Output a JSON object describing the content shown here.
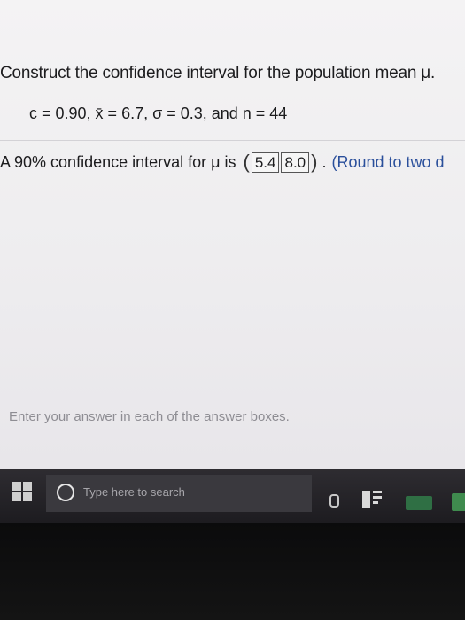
{
  "question": {
    "prompt": "Construct the confidence interval for the population mean μ.",
    "given": "c = 0.90, x̄ = 6.7, σ = 0.3, and n = 44"
  },
  "answer": {
    "prefix": "A 90% confidence interval for μ is",
    "open_paren": "(",
    "lower_value": "5.4",
    "upper_value": "8.0",
    "close_paren": ")",
    "dot": ".",
    "round_note": "(Round to two d"
  },
  "hint": "Enter your answer in each of the answer boxes.",
  "taskbar": {
    "search_placeholder": "Type here to search"
  },
  "colors": {
    "text": "#1c1c1e",
    "round_note": "#2a4f9b",
    "hint": "#8e8d93",
    "taskbar": "#1d1c20"
  }
}
